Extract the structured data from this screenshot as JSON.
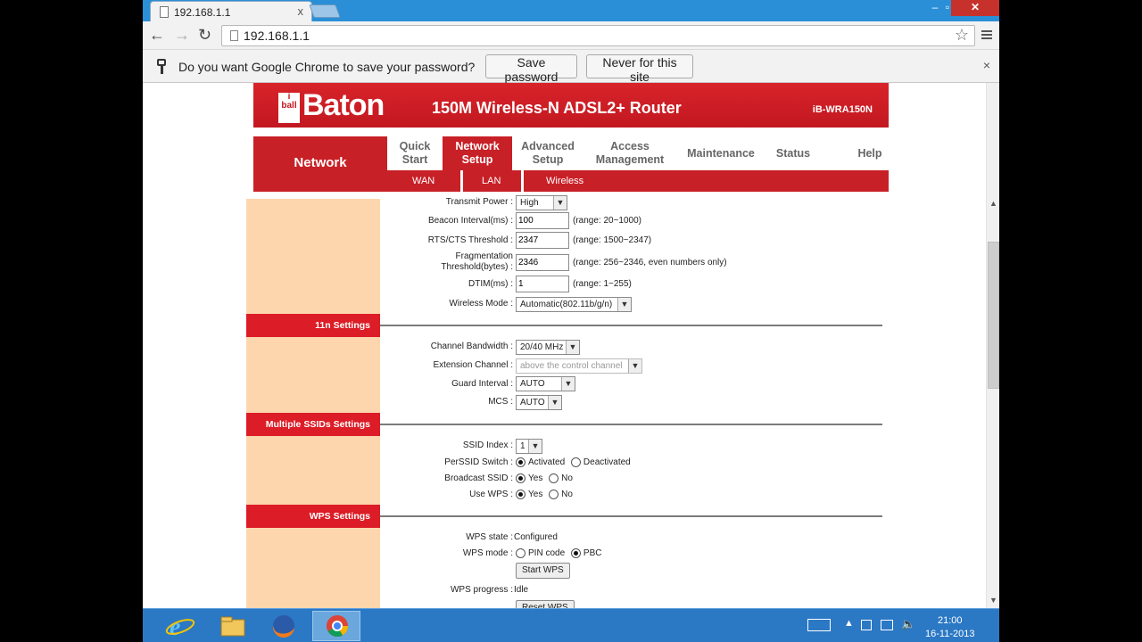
{
  "browser": {
    "tab_title": "192.168.1.1",
    "tab_close": "x",
    "url": "192.168.1.1",
    "window_controls": {
      "minimize": "–",
      "maximize": "▫",
      "close": "✕"
    },
    "icons": {
      "back": "arrow-left",
      "forward": "arrow-right",
      "reload": "reload",
      "star": "bookmark-star",
      "menu": "hamburger"
    }
  },
  "infobar": {
    "message": "Do you want Google Chrome to save your password?",
    "save_button": "Save password",
    "never_button": "Never for this site",
    "close": "×"
  },
  "router": {
    "brand": "Baton",
    "brand_small": "i",
    "brand_sub": "ball",
    "product": "150M Wireless-N ADSL2+ Router",
    "model": "iB-WRA150N",
    "section": "Network",
    "menu": [
      {
        "label_line1": "Quick",
        "label_line2": "Start"
      },
      {
        "label_line1": "Network",
        "label_line2": "Setup"
      },
      {
        "label_line1": "Advanced",
        "label_line2": "Setup"
      },
      {
        "label_line1": "Access",
        "label_line2": "Management"
      },
      {
        "label_line1": "Maintenance",
        "label_line2": ""
      },
      {
        "label_line1": "Status",
        "label_line2": ""
      },
      {
        "label_line1": "Help",
        "label_line2": ""
      }
    ],
    "submenu": [
      "WAN",
      "LAN",
      "Wireless"
    ],
    "wireless": {
      "transmit_power_label": "Transmit Power :",
      "transmit_power": "High",
      "beacon_label": "Beacon Interval(ms) :",
      "beacon": "100",
      "beacon_hint": "(range: 20~1000)",
      "rts_label": "RTS/CTS Threshold :",
      "rts": "2347",
      "rts_hint": "(range: 1500~2347)",
      "frag_label_1": "Fragmentation",
      "frag_label_2": "Threshold(bytes) :",
      "frag": "2346",
      "frag_hint": "(range: 256~2346, even numbers only)",
      "dtim_label": "DTIM(ms) :",
      "dtim": "1",
      "dtim_hint": "(range: 1~255)",
      "mode_label": "Wireless Mode :",
      "mode": "Automatic(802.11b/g/n)"
    },
    "n11": {
      "title": "11n Settings",
      "bandwidth_label": "Channel Bandwidth :",
      "bandwidth": "20/40 MHz",
      "extension_label": "Extension Channel :",
      "extension": "above the control channel",
      "guard_label": "Guard Interval :",
      "guard": "AUTO",
      "mcs_label": "MCS :",
      "mcs": "AUTO"
    },
    "ssid": {
      "title": "Multiple SSIDs Settings",
      "index_label": "SSID Index :",
      "index": "1",
      "switch_label": "PerSSID Switch :",
      "activated": "Activated",
      "deactivated": "Deactivated",
      "broadcast_label": "Broadcast SSID :",
      "wps_label": "Use WPS :",
      "yes": "Yes",
      "no": "No"
    },
    "wps": {
      "title": "WPS Settings",
      "state_label": "WPS state :",
      "state": "Configured",
      "mode_label": "WPS mode :",
      "pin": "PIN code",
      "pbc": "PBC",
      "start_button": "Start WPS",
      "progress_label": "WPS progress :",
      "progress": "Idle",
      "reset_button": "Reset WPS"
    }
  },
  "taskbar": {
    "time": "21:00",
    "date": "16-11-2013",
    "apps": [
      "internet-explorer-icon",
      "file-explorer-icon",
      "firefox-icon",
      "chrome-icon"
    ]
  },
  "colors": {
    "router_red": "#c82027",
    "band_red": "#dc1c26",
    "sidebar": "#fdd6ad",
    "chrome_blue": "#2a8fd6",
    "taskbar": "#2b78c4"
  }
}
